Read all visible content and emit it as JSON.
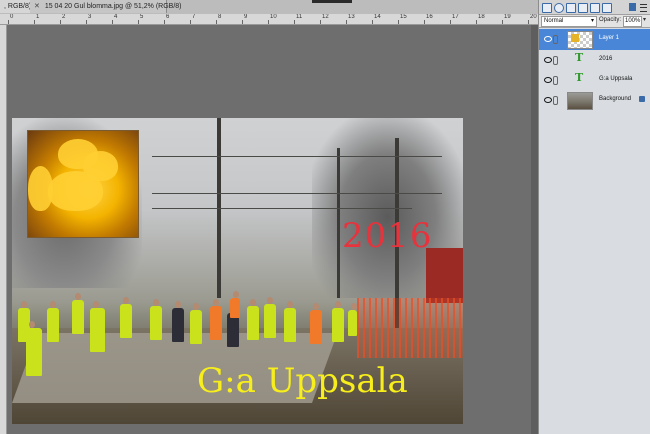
{
  "tabs": [
    {
      "label": ", RGB/8) *",
      "active": true
    },
    {
      "label": "15 04 20 Gul blomma.jpg @ 51,2% (RGB/8)",
      "active": false
    }
  ],
  "ruler_numbers": [
    "0",
    "1",
    "2",
    "3",
    "4",
    "5",
    "6",
    "7",
    "8",
    "9",
    "10",
    "11",
    "12",
    "13",
    "14",
    "15",
    "16",
    "17",
    "18",
    "19",
    "20"
  ],
  "canvas": {
    "text_2016": "2016",
    "text_place": "G:a Uppsala",
    "text_2016_color": "#e8323c",
    "text_place_color": "#f7ee1c"
  },
  "panel": {
    "blend_mode": "Normal",
    "opacity_label": "Opacity:",
    "opacity_value": "100%",
    "layers": [
      {
        "name": "Layer 1",
        "type": "pixel",
        "selected": true
      },
      {
        "name": "2016",
        "type": "text",
        "selected": false
      },
      {
        "name": "G:a Uppsala",
        "type": "text",
        "selected": false
      },
      {
        "name": "Background",
        "type": "pixel",
        "selected": false,
        "locked": true
      }
    ],
    "toolbar_icons": [
      "new-layer-icon",
      "adjust-icon",
      "mask-icon",
      "link-icon",
      "fx-icon",
      "lock-icon",
      "trash-icon",
      "menu-icon"
    ],
    "selection_color": "#4a86d8"
  }
}
